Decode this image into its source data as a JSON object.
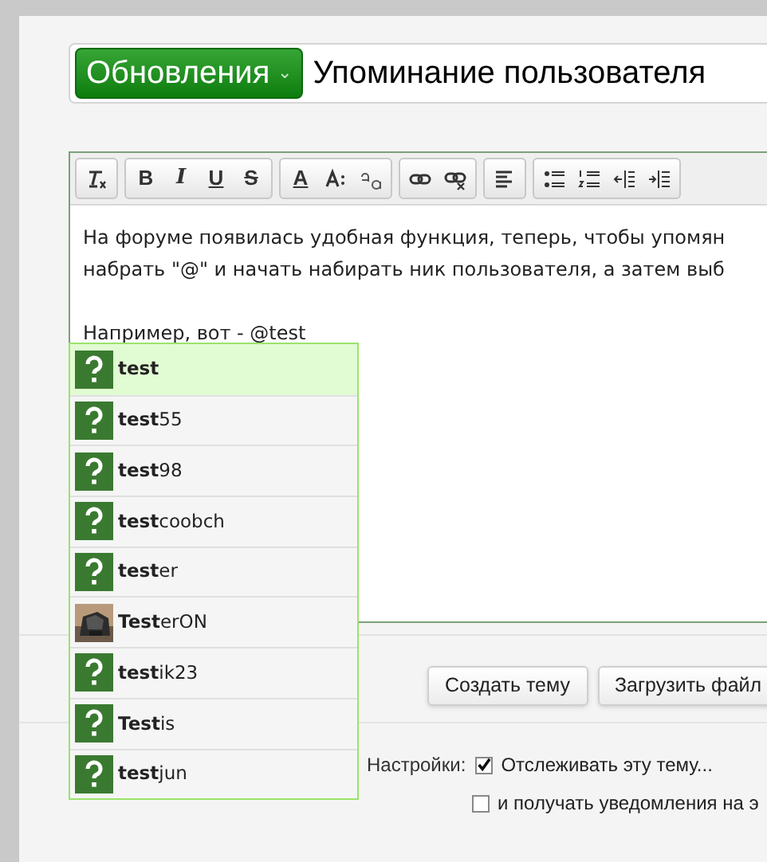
{
  "title_bar": {
    "prefix_button": {
      "label": "Обновления",
      "caret": "⌄"
    },
    "title": "Упоминание пользователя"
  },
  "toolbar": {
    "groups": [
      {
        "items": [
          {
            "kind": "icon"
          }
        ]
      },
      {
        "items": [
          {
            "kind": "label",
            "label": "B"
          },
          {
            "kind": "label",
            "label": "I"
          },
          {
            "kind": "label",
            "label": "U"
          },
          {
            "kind": "label",
            "label": "S"
          }
        ]
      },
      {
        "items": [
          {
            "kind": "label",
            "label": "A"
          },
          {
            "kind": "icon"
          },
          {
            "kind": "icon"
          }
        ]
      },
      {
        "items": [
          {
            "kind": "icon"
          },
          {
            "kind": "icon"
          }
        ]
      },
      {
        "items": [
          {
            "kind": "icon"
          }
        ]
      },
      {
        "items": [
          {
            "kind": "icon"
          },
          {
            "kind": "icon"
          },
          {
            "kind": "icon"
          },
          {
            "kind": "icon"
          }
        ]
      }
    ]
  },
  "editor": {
    "paragraphs": [
      "На форуме появилась удобная функция, теперь, чтобы упомян",
      "набрать \"@\" и начать набирать ник пользователя, а затем выб"
    ],
    "example": "Например, вот - @test"
  },
  "mention_suggestions": [
    {
      "name": "**test**",
      "kind": "question",
      "selected": true
    },
    {
      "name": "**test**55",
      "kind": "question",
      "selected": false
    },
    {
      "name": "**test**98",
      "kind": "question",
      "selected": false
    },
    {
      "name": "**test**coobch",
      "kind": "question",
      "selected": false
    },
    {
      "name": "**test**er",
      "kind": "question",
      "selected": false
    },
    {
      "name": "**Test**erON",
      "kind": "picture",
      "selected": false
    },
    {
      "name": "**test**ik23",
      "kind": "question",
      "selected": false
    },
    {
      "name": "**Test**is",
      "kind": "question",
      "selected": false
    },
    {
      "name": "**test**jun",
      "kind": "question",
      "selected": false
    }
  ],
  "buttons": [
    "Создать тему",
    "Загрузить файл"
  ],
  "settings": {
    "label": "Настройки:",
    "options": [
      {
        "label": "Отслеживать эту тему...",
        "checked": true
      },
      {
        "label": "и получать уведомления на э",
        "checked": false
      }
    ]
  }
}
